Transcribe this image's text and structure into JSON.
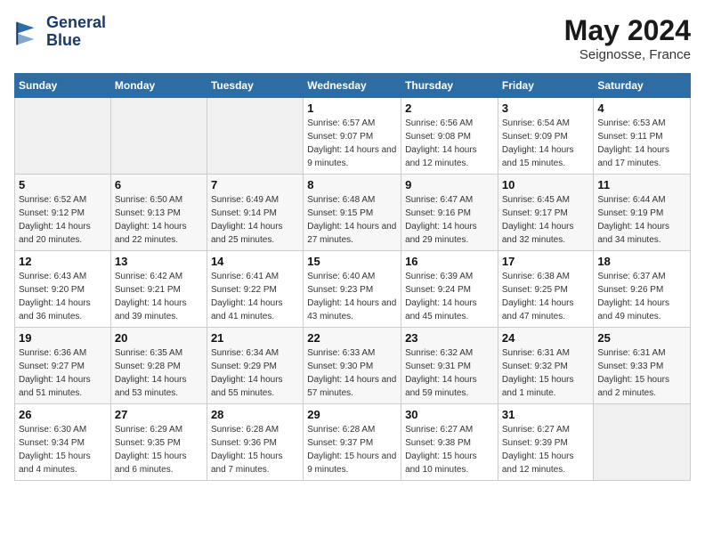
{
  "header": {
    "logo_line1": "General",
    "logo_line2": "Blue",
    "month_year": "May 2024",
    "location": "Seignosse, France"
  },
  "days_of_week": [
    "Sunday",
    "Monday",
    "Tuesday",
    "Wednesday",
    "Thursday",
    "Friday",
    "Saturday"
  ],
  "weeks": [
    [
      {
        "day": "",
        "sunrise": "",
        "sunset": "",
        "daylight": ""
      },
      {
        "day": "",
        "sunrise": "",
        "sunset": "",
        "daylight": ""
      },
      {
        "day": "",
        "sunrise": "",
        "sunset": "",
        "daylight": ""
      },
      {
        "day": "1",
        "sunrise": "Sunrise: 6:57 AM",
        "sunset": "Sunset: 9:07 PM",
        "daylight": "Daylight: 14 hours and 9 minutes."
      },
      {
        "day": "2",
        "sunrise": "Sunrise: 6:56 AM",
        "sunset": "Sunset: 9:08 PM",
        "daylight": "Daylight: 14 hours and 12 minutes."
      },
      {
        "day": "3",
        "sunrise": "Sunrise: 6:54 AM",
        "sunset": "Sunset: 9:09 PM",
        "daylight": "Daylight: 14 hours and 15 minutes."
      },
      {
        "day": "4",
        "sunrise": "Sunrise: 6:53 AM",
        "sunset": "Sunset: 9:11 PM",
        "daylight": "Daylight: 14 hours and 17 minutes."
      }
    ],
    [
      {
        "day": "5",
        "sunrise": "Sunrise: 6:52 AM",
        "sunset": "Sunset: 9:12 PM",
        "daylight": "Daylight: 14 hours and 20 minutes."
      },
      {
        "day": "6",
        "sunrise": "Sunrise: 6:50 AM",
        "sunset": "Sunset: 9:13 PM",
        "daylight": "Daylight: 14 hours and 22 minutes."
      },
      {
        "day": "7",
        "sunrise": "Sunrise: 6:49 AM",
        "sunset": "Sunset: 9:14 PM",
        "daylight": "Daylight: 14 hours and 25 minutes."
      },
      {
        "day": "8",
        "sunrise": "Sunrise: 6:48 AM",
        "sunset": "Sunset: 9:15 PM",
        "daylight": "Daylight: 14 hours and 27 minutes."
      },
      {
        "day": "9",
        "sunrise": "Sunrise: 6:47 AM",
        "sunset": "Sunset: 9:16 PM",
        "daylight": "Daylight: 14 hours and 29 minutes."
      },
      {
        "day": "10",
        "sunrise": "Sunrise: 6:45 AM",
        "sunset": "Sunset: 9:17 PM",
        "daylight": "Daylight: 14 hours and 32 minutes."
      },
      {
        "day": "11",
        "sunrise": "Sunrise: 6:44 AM",
        "sunset": "Sunset: 9:19 PM",
        "daylight": "Daylight: 14 hours and 34 minutes."
      }
    ],
    [
      {
        "day": "12",
        "sunrise": "Sunrise: 6:43 AM",
        "sunset": "Sunset: 9:20 PM",
        "daylight": "Daylight: 14 hours and 36 minutes."
      },
      {
        "day": "13",
        "sunrise": "Sunrise: 6:42 AM",
        "sunset": "Sunset: 9:21 PM",
        "daylight": "Daylight: 14 hours and 39 minutes."
      },
      {
        "day": "14",
        "sunrise": "Sunrise: 6:41 AM",
        "sunset": "Sunset: 9:22 PM",
        "daylight": "Daylight: 14 hours and 41 minutes."
      },
      {
        "day": "15",
        "sunrise": "Sunrise: 6:40 AM",
        "sunset": "Sunset: 9:23 PM",
        "daylight": "Daylight: 14 hours and 43 minutes."
      },
      {
        "day": "16",
        "sunrise": "Sunrise: 6:39 AM",
        "sunset": "Sunset: 9:24 PM",
        "daylight": "Daylight: 14 hours and 45 minutes."
      },
      {
        "day": "17",
        "sunrise": "Sunrise: 6:38 AM",
        "sunset": "Sunset: 9:25 PM",
        "daylight": "Daylight: 14 hours and 47 minutes."
      },
      {
        "day": "18",
        "sunrise": "Sunrise: 6:37 AM",
        "sunset": "Sunset: 9:26 PM",
        "daylight": "Daylight: 14 hours and 49 minutes."
      }
    ],
    [
      {
        "day": "19",
        "sunrise": "Sunrise: 6:36 AM",
        "sunset": "Sunset: 9:27 PM",
        "daylight": "Daylight: 14 hours and 51 minutes."
      },
      {
        "day": "20",
        "sunrise": "Sunrise: 6:35 AM",
        "sunset": "Sunset: 9:28 PM",
        "daylight": "Daylight: 14 hours and 53 minutes."
      },
      {
        "day": "21",
        "sunrise": "Sunrise: 6:34 AM",
        "sunset": "Sunset: 9:29 PM",
        "daylight": "Daylight: 14 hours and 55 minutes."
      },
      {
        "day": "22",
        "sunrise": "Sunrise: 6:33 AM",
        "sunset": "Sunset: 9:30 PM",
        "daylight": "Daylight: 14 hours and 57 minutes."
      },
      {
        "day": "23",
        "sunrise": "Sunrise: 6:32 AM",
        "sunset": "Sunset: 9:31 PM",
        "daylight": "Daylight: 14 hours and 59 minutes."
      },
      {
        "day": "24",
        "sunrise": "Sunrise: 6:31 AM",
        "sunset": "Sunset: 9:32 PM",
        "daylight": "Daylight: 15 hours and 1 minute."
      },
      {
        "day": "25",
        "sunrise": "Sunrise: 6:31 AM",
        "sunset": "Sunset: 9:33 PM",
        "daylight": "Daylight: 15 hours and 2 minutes."
      }
    ],
    [
      {
        "day": "26",
        "sunrise": "Sunrise: 6:30 AM",
        "sunset": "Sunset: 9:34 PM",
        "daylight": "Daylight: 15 hours and 4 minutes."
      },
      {
        "day": "27",
        "sunrise": "Sunrise: 6:29 AM",
        "sunset": "Sunset: 9:35 PM",
        "daylight": "Daylight: 15 hours and 6 minutes."
      },
      {
        "day": "28",
        "sunrise": "Sunrise: 6:28 AM",
        "sunset": "Sunset: 9:36 PM",
        "daylight": "Daylight: 15 hours and 7 minutes."
      },
      {
        "day": "29",
        "sunrise": "Sunrise: 6:28 AM",
        "sunset": "Sunset: 9:37 PM",
        "daylight": "Daylight: 15 hours and 9 minutes."
      },
      {
        "day": "30",
        "sunrise": "Sunrise: 6:27 AM",
        "sunset": "Sunset: 9:38 PM",
        "daylight": "Daylight: 15 hours and 10 minutes."
      },
      {
        "day": "31",
        "sunrise": "Sunrise: 6:27 AM",
        "sunset": "Sunset: 9:39 PM",
        "daylight": "Daylight: 15 hours and 12 minutes."
      },
      {
        "day": "",
        "sunrise": "",
        "sunset": "",
        "daylight": ""
      }
    ]
  ]
}
